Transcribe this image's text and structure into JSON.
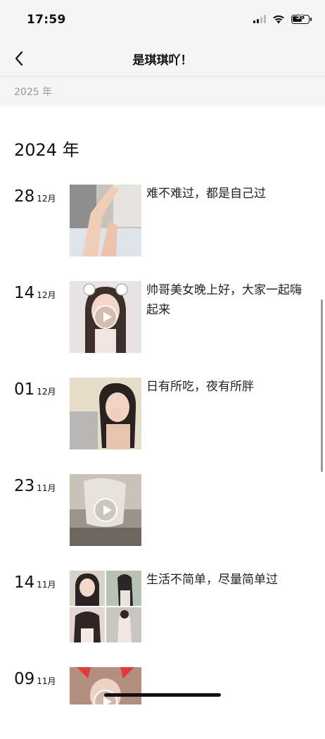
{
  "status_bar": {
    "time": "17:59",
    "battery": "53"
  },
  "header": {
    "title": "是琪琪吖！",
    "back_icon": "chevron-left-icon"
  },
  "year_filter": {
    "label": "2025 年"
  },
  "section": {
    "year": "2024 年"
  },
  "posts": [
    {
      "day": "28",
      "month": "12月",
      "caption": "难不难过，都是自己过",
      "media": "photo"
    },
    {
      "day": "14",
      "month": "12月",
      "caption": "帅哥美女晚上好，大家一起嗨起来",
      "media": "video"
    },
    {
      "day": "01",
      "month": "12月",
      "caption": "日有所吃，夜有所胖",
      "media": "photo"
    },
    {
      "day": "23",
      "month": "11月",
      "caption": "",
      "media": "video"
    },
    {
      "day": "14",
      "month": "11月",
      "caption": "生活不简单，尽量简单过",
      "media": "photo-grid"
    },
    {
      "day": "09",
      "month": "11月",
      "caption": "",
      "media": "video"
    }
  ]
}
